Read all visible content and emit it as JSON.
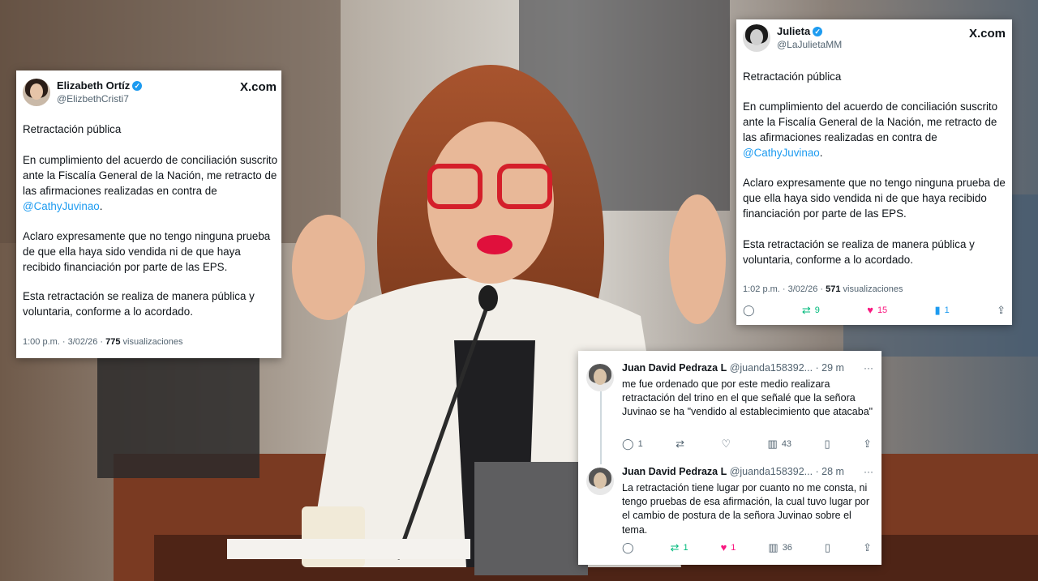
{
  "card_a": {
    "name": "Elizabeth Ortíz",
    "handle": "@ElizbethCristi7",
    "site": "X.com",
    "title": "Retractación pública",
    "p1": "En cumplimiento del acuerdo de conciliación suscrito ante la Fiscalía General de la Nación, me retracto de las afirmaciones realizadas en contra de ",
    "mention": "@CathyJuvinao",
    "p1_end": ".",
    "p2": "Aclaro expresamente que no tengo ninguna prueba de que ella haya sido vendida ni de que haya recibido financiación por parte de las EPS.",
    "p3": "Esta retractación se realiza de manera pública y voluntaria, conforme a lo acordado.",
    "meta_time": "1:00 p.m. · 3/02/26 · ",
    "views": "775",
    "views_label": " visualizaciones"
  },
  "card_b": {
    "name": "Julieta",
    "handle": "@LaJulietaMM",
    "site": "X.com",
    "title": "Retractación pública",
    "p1": "En cumplimiento del acuerdo de conciliación suscrito ante la Fiscalía General de la Nación, me retracto de las afirmaciones realizadas en contra de ",
    "mention": "@CathyJuvinao",
    "p1_end": ".",
    "p2": "Aclaro expresamente que no tengo ninguna prueba de que ella haya sido vendida ni de que haya recibido financiación por parte de las EPS.",
    "p3": "Esta retractación se realiza de manera pública y voluntaria, conforme a lo acordado.",
    "meta_time": "1:02 p.m. · 3/02/26 · ",
    "views": "571",
    "views_label": " visualizaciones",
    "actions": {
      "reposts": "9",
      "likes": "15",
      "bookmarks": "1"
    },
    "icons": [
      "reply-icon",
      "repost-icon",
      "heart-icon",
      "bookmark-icon",
      "share-icon"
    ]
  },
  "card_c": {
    "reply1": {
      "name": "Juan David Pedraza L",
      "handle": "@juanda158392...",
      "time": "· 29 m",
      "text": "me fue ordenado que por este medio realizara retractación del trino en el que señalé que la señora Juvinao se ha \"vendido al establecimiento que atacaba\"",
      "replies": "1",
      "reposts": "",
      "likes": "",
      "views": "43"
    },
    "reply2": {
      "name": "Juan David Pedraza L",
      "handle": "@juanda158392...",
      "time": "· 28 m",
      "text": "La retractación tiene lugar por cuanto no me consta, ni tengo pruebas de esa afirmación, la cual tuvo lugar por el cambio de postura de la señora Juvinao sobre el tema.",
      "replies": "",
      "reposts": "1",
      "likes": "1",
      "views": "36"
    }
  },
  "colors": {
    "link": "#1d9bf0",
    "repost": "#00ba7c",
    "like": "#f91880",
    "muted": "#536471"
  }
}
